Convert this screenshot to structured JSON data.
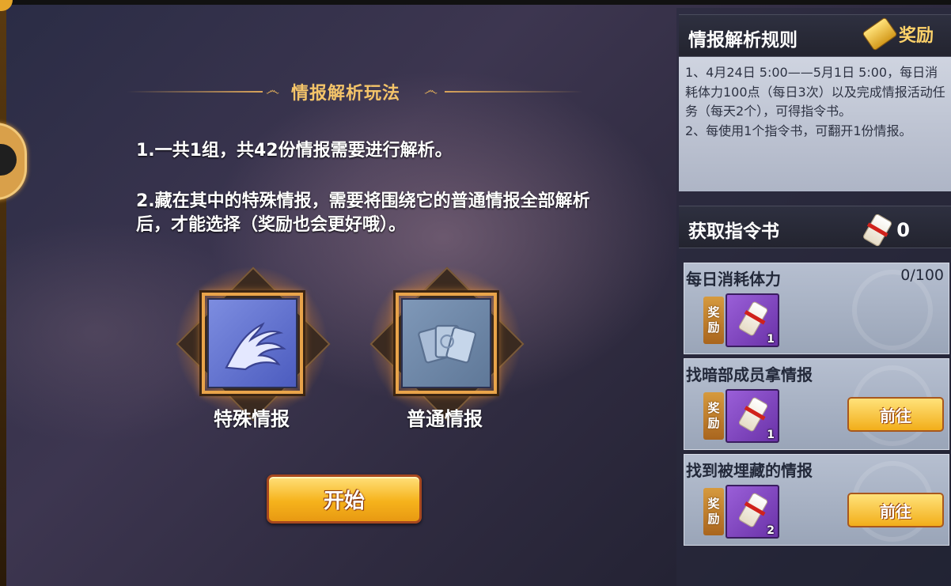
{
  "left": {
    "section_title": "情报解析玩法",
    "rules": [
      "1.一共1组，共42份情报需要进行解析。",
      "2.藏在其中的特殊情报，需要将围绕它的普通情报全部解析后，才能选择（奖励也会更好哦）。"
    ],
    "cards": {
      "special_label": "特殊情报",
      "normal_label": "普通情报"
    },
    "start_button": "开始"
  },
  "right": {
    "rules_header": "情报解析规则",
    "reward_button": "奖励",
    "rules_text": "1、4月24日 5:00——5月1日 5:00，每日消耗体力100点（每日3次）以及完成情报活动任务（每天2个），可得指令书。\n2、每使用1个指令书，可翻开1份情报。",
    "get_header": "获取指令书",
    "command_book_count": "0",
    "tasks": [
      {
        "title": "每日消耗体力",
        "progress": "0/100",
        "reward_tag": "奖励",
        "item_count": "1",
        "button": ""
      },
      {
        "title": "找暗部成员拿情报",
        "progress": "",
        "reward_tag": "奖励",
        "item_count": "1",
        "button": "前往"
      },
      {
        "title": "找到被埋藏的情报",
        "progress": "",
        "reward_tag": "奖励",
        "item_count": "2",
        "button": "前往"
      }
    ]
  },
  "colors": {
    "accent_gold": "#f4c469",
    "button_gold": "#f6b31c",
    "item_purple": "#7a3fc0"
  }
}
